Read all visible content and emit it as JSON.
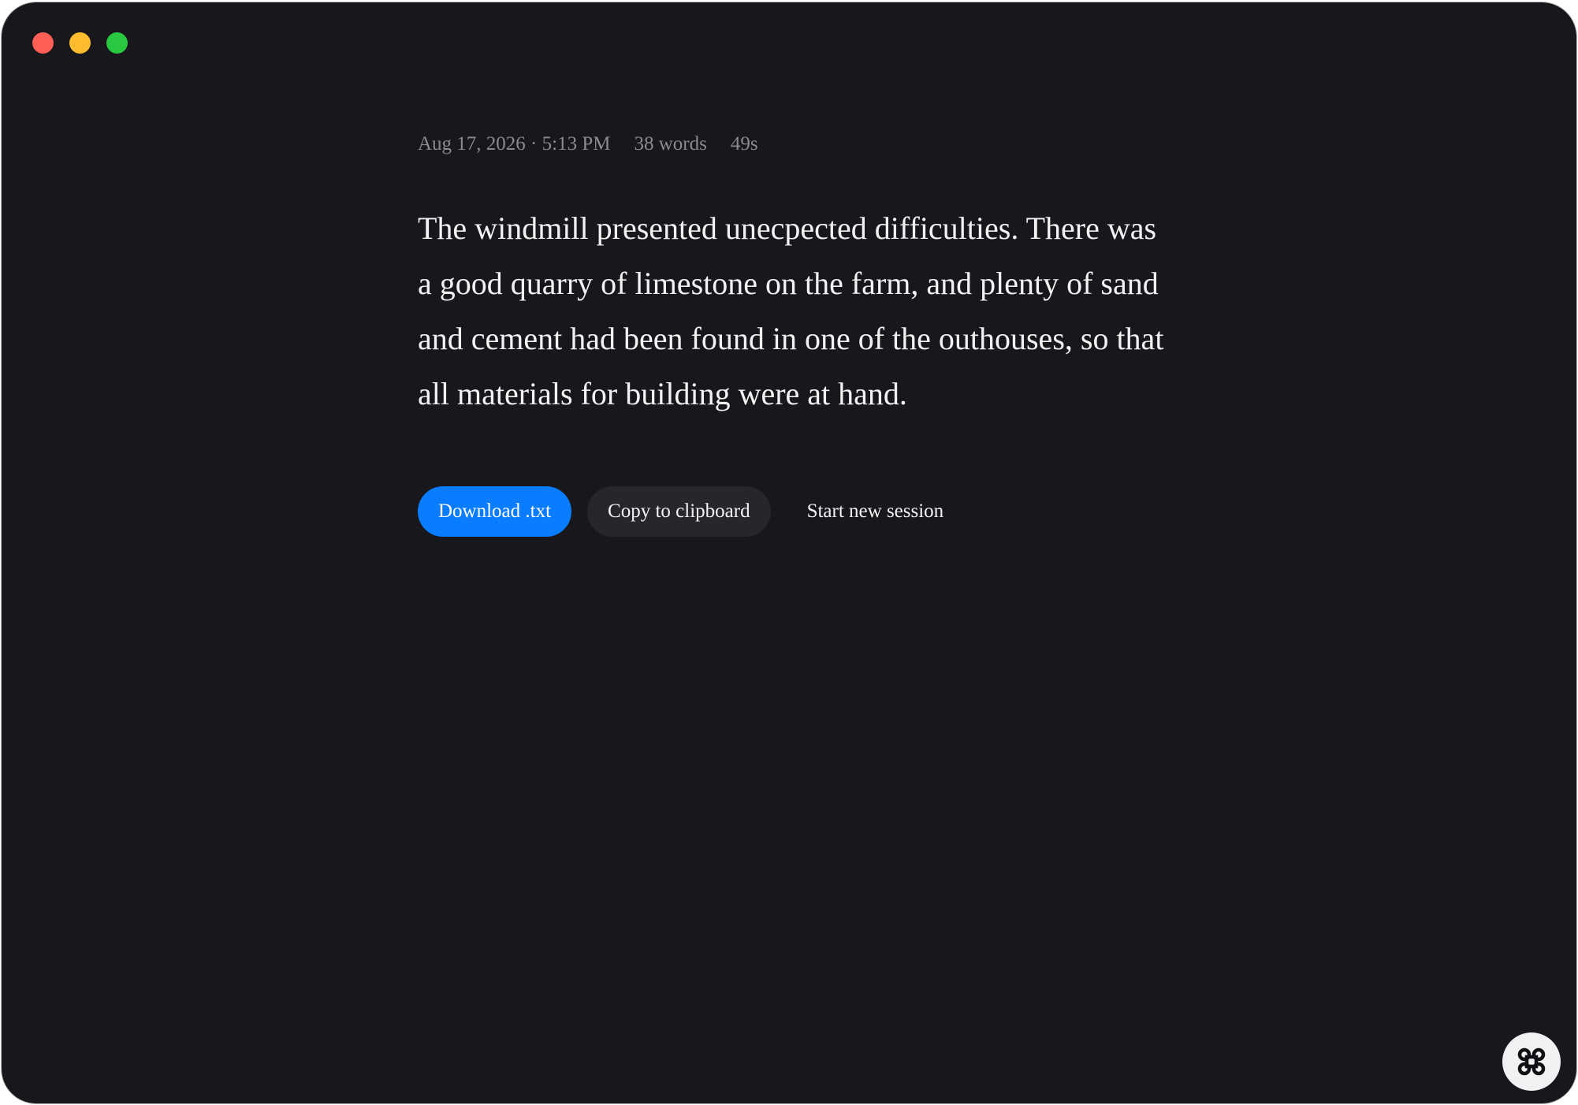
{
  "window": {
    "controls": [
      {
        "name": "close",
        "color": "#ff5f57"
      },
      {
        "name": "minimize",
        "color": "#febc2e"
      },
      {
        "name": "maximize",
        "color": "#28c840"
      }
    ]
  },
  "meta": {
    "datetime": "Aug 17, 2026 · 5:13 PM",
    "word_count": "38 words",
    "duration": "49s"
  },
  "transcript": {
    "text": "The windmill presented unecpected difficulties. There was a good quarry of limestone on the farm, and plenty of sand and cement had been found in one of the outhouses, so that all materials for building were at hand."
  },
  "actions": {
    "download_label": "Download .txt",
    "copy_label": "Copy to clipboard",
    "new_session_label": "Start new session"
  },
  "colors": {
    "background": "#17171c",
    "accent": "#0a7cff",
    "secondary_button": "#26262c",
    "muted_text": "#8a8a90"
  },
  "fab": {
    "icon": "command-icon"
  }
}
